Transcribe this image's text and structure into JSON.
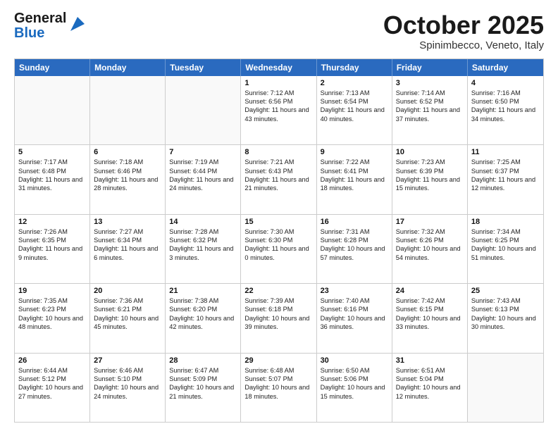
{
  "header": {
    "logo_general": "General",
    "logo_blue": "Blue",
    "month_title": "October 2025",
    "location": "Spinimbecco, Veneto, Italy"
  },
  "calendar": {
    "days_of_week": [
      "Sunday",
      "Monday",
      "Tuesday",
      "Wednesday",
      "Thursday",
      "Friday",
      "Saturday"
    ],
    "rows": [
      [
        {
          "day": "",
          "sunrise": "",
          "sunset": "",
          "daylight": ""
        },
        {
          "day": "",
          "sunrise": "",
          "sunset": "",
          "daylight": ""
        },
        {
          "day": "",
          "sunrise": "",
          "sunset": "",
          "daylight": ""
        },
        {
          "day": "1",
          "sunrise": "Sunrise: 7:12 AM",
          "sunset": "Sunset: 6:56 PM",
          "daylight": "Daylight: 11 hours and 43 minutes."
        },
        {
          "day": "2",
          "sunrise": "Sunrise: 7:13 AM",
          "sunset": "Sunset: 6:54 PM",
          "daylight": "Daylight: 11 hours and 40 minutes."
        },
        {
          "day": "3",
          "sunrise": "Sunrise: 7:14 AM",
          "sunset": "Sunset: 6:52 PM",
          "daylight": "Daylight: 11 hours and 37 minutes."
        },
        {
          "day": "4",
          "sunrise": "Sunrise: 7:16 AM",
          "sunset": "Sunset: 6:50 PM",
          "daylight": "Daylight: 11 hours and 34 minutes."
        }
      ],
      [
        {
          "day": "5",
          "sunrise": "Sunrise: 7:17 AM",
          "sunset": "Sunset: 6:48 PM",
          "daylight": "Daylight: 11 hours and 31 minutes."
        },
        {
          "day": "6",
          "sunrise": "Sunrise: 7:18 AM",
          "sunset": "Sunset: 6:46 PM",
          "daylight": "Daylight: 11 hours and 28 minutes."
        },
        {
          "day": "7",
          "sunrise": "Sunrise: 7:19 AM",
          "sunset": "Sunset: 6:44 PM",
          "daylight": "Daylight: 11 hours and 24 minutes."
        },
        {
          "day": "8",
          "sunrise": "Sunrise: 7:21 AM",
          "sunset": "Sunset: 6:43 PM",
          "daylight": "Daylight: 11 hours and 21 minutes."
        },
        {
          "day": "9",
          "sunrise": "Sunrise: 7:22 AM",
          "sunset": "Sunset: 6:41 PM",
          "daylight": "Daylight: 11 hours and 18 minutes."
        },
        {
          "day": "10",
          "sunrise": "Sunrise: 7:23 AM",
          "sunset": "Sunset: 6:39 PM",
          "daylight": "Daylight: 11 hours and 15 minutes."
        },
        {
          "day": "11",
          "sunrise": "Sunrise: 7:25 AM",
          "sunset": "Sunset: 6:37 PM",
          "daylight": "Daylight: 11 hours and 12 minutes."
        }
      ],
      [
        {
          "day": "12",
          "sunrise": "Sunrise: 7:26 AM",
          "sunset": "Sunset: 6:35 PM",
          "daylight": "Daylight: 11 hours and 9 minutes."
        },
        {
          "day": "13",
          "sunrise": "Sunrise: 7:27 AM",
          "sunset": "Sunset: 6:34 PM",
          "daylight": "Daylight: 11 hours and 6 minutes."
        },
        {
          "day": "14",
          "sunrise": "Sunrise: 7:28 AM",
          "sunset": "Sunset: 6:32 PM",
          "daylight": "Daylight: 11 hours and 3 minutes."
        },
        {
          "day": "15",
          "sunrise": "Sunrise: 7:30 AM",
          "sunset": "Sunset: 6:30 PM",
          "daylight": "Daylight: 11 hours and 0 minutes."
        },
        {
          "day": "16",
          "sunrise": "Sunrise: 7:31 AM",
          "sunset": "Sunset: 6:28 PM",
          "daylight": "Daylight: 10 hours and 57 minutes."
        },
        {
          "day": "17",
          "sunrise": "Sunrise: 7:32 AM",
          "sunset": "Sunset: 6:26 PM",
          "daylight": "Daylight: 10 hours and 54 minutes."
        },
        {
          "day": "18",
          "sunrise": "Sunrise: 7:34 AM",
          "sunset": "Sunset: 6:25 PM",
          "daylight": "Daylight: 10 hours and 51 minutes."
        }
      ],
      [
        {
          "day": "19",
          "sunrise": "Sunrise: 7:35 AM",
          "sunset": "Sunset: 6:23 PM",
          "daylight": "Daylight: 10 hours and 48 minutes."
        },
        {
          "day": "20",
          "sunrise": "Sunrise: 7:36 AM",
          "sunset": "Sunset: 6:21 PM",
          "daylight": "Daylight: 10 hours and 45 minutes."
        },
        {
          "day": "21",
          "sunrise": "Sunrise: 7:38 AM",
          "sunset": "Sunset: 6:20 PM",
          "daylight": "Daylight: 10 hours and 42 minutes."
        },
        {
          "day": "22",
          "sunrise": "Sunrise: 7:39 AM",
          "sunset": "Sunset: 6:18 PM",
          "daylight": "Daylight: 10 hours and 39 minutes."
        },
        {
          "day": "23",
          "sunrise": "Sunrise: 7:40 AM",
          "sunset": "Sunset: 6:16 PM",
          "daylight": "Daylight: 10 hours and 36 minutes."
        },
        {
          "day": "24",
          "sunrise": "Sunrise: 7:42 AM",
          "sunset": "Sunset: 6:15 PM",
          "daylight": "Daylight: 10 hours and 33 minutes."
        },
        {
          "day": "25",
          "sunrise": "Sunrise: 7:43 AM",
          "sunset": "Sunset: 6:13 PM",
          "daylight": "Daylight: 10 hours and 30 minutes."
        }
      ],
      [
        {
          "day": "26",
          "sunrise": "Sunrise: 6:44 AM",
          "sunset": "Sunset: 5:12 PM",
          "daylight": "Daylight: 10 hours and 27 minutes."
        },
        {
          "day": "27",
          "sunrise": "Sunrise: 6:46 AM",
          "sunset": "Sunset: 5:10 PM",
          "daylight": "Daylight: 10 hours and 24 minutes."
        },
        {
          "day": "28",
          "sunrise": "Sunrise: 6:47 AM",
          "sunset": "Sunset: 5:09 PM",
          "daylight": "Daylight: 10 hours and 21 minutes."
        },
        {
          "day": "29",
          "sunrise": "Sunrise: 6:48 AM",
          "sunset": "Sunset: 5:07 PM",
          "daylight": "Daylight: 10 hours and 18 minutes."
        },
        {
          "day": "30",
          "sunrise": "Sunrise: 6:50 AM",
          "sunset": "Sunset: 5:06 PM",
          "daylight": "Daylight: 10 hours and 15 minutes."
        },
        {
          "day": "31",
          "sunrise": "Sunrise: 6:51 AM",
          "sunset": "Sunset: 5:04 PM",
          "daylight": "Daylight: 10 hours and 12 minutes."
        },
        {
          "day": "",
          "sunrise": "",
          "sunset": "",
          "daylight": ""
        }
      ]
    ]
  }
}
